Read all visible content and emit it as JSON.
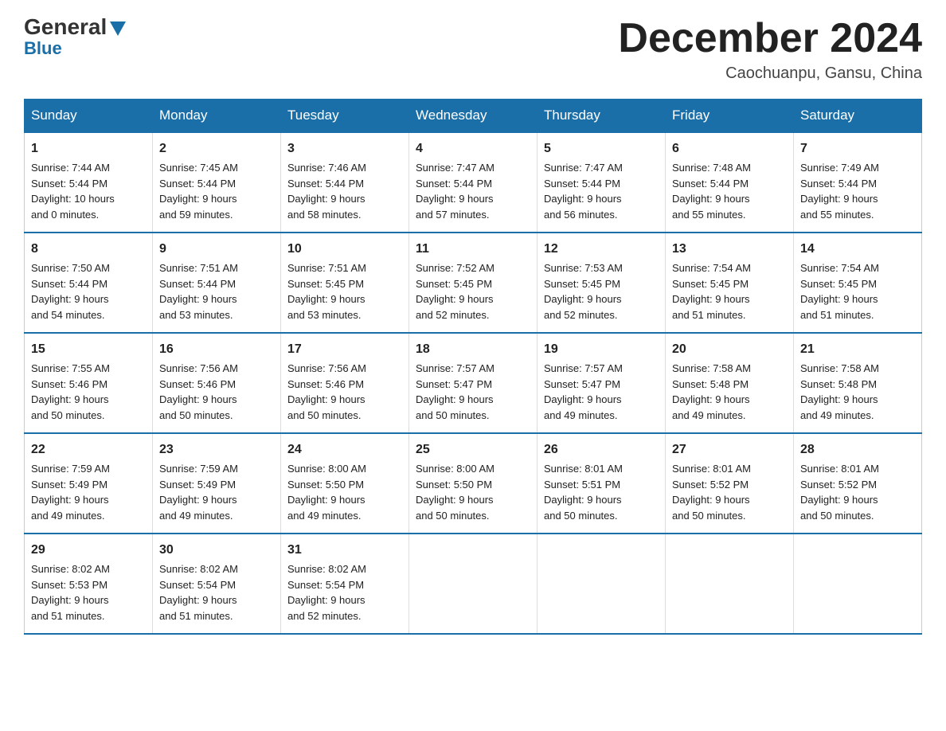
{
  "logo": {
    "general": "General",
    "blue": "Blue"
  },
  "title": "December 2024",
  "location": "Caochuanpu, Gansu, China",
  "days_header": [
    "Sunday",
    "Monday",
    "Tuesday",
    "Wednesday",
    "Thursday",
    "Friday",
    "Saturday"
  ],
  "weeks": [
    [
      {
        "day": "1",
        "info": "Sunrise: 7:44 AM\nSunset: 5:44 PM\nDaylight: 10 hours\nand 0 minutes."
      },
      {
        "day": "2",
        "info": "Sunrise: 7:45 AM\nSunset: 5:44 PM\nDaylight: 9 hours\nand 59 minutes."
      },
      {
        "day": "3",
        "info": "Sunrise: 7:46 AM\nSunset: 5:44 PM\nDaylight: 9 hours\nand 58 minutes."
      },
      {
        "day": "4",
        "info": "Sunrise: 7:47 AM\nSunset: 5:44 PM\nDaylight: 9 hours\nand 57 minutes."
      },
      {
        "day": "5",
        "info": "Sunrise: 7:47 AM\nSunset: 5:44 PM\nDaylight: 9 hours\nand 56 minutes."
      },
      {
        "day": "6",
        "info": "Sunrise: 7:48 AM\nSunset: 5:44 PM\nDaylight: 9 hours\nand 55 minutes."
      },
      {
        "day": "7",
        "info": "Sunrise: 7:49 AM\nSunset: 5:44 PM\nDaylight: 9 hours\nand 55 minutes."
      }
    ],
    [
      {
        "day": "8",
        "info": "Sunrise: 7:50 AM\nSunset: 5:44 PM\nDaylight: 9 hours\nand 54 minutes."
      },
      {
        "day": "9",
        "info": "Sunrise: 7:51 AM\nSunset: 5:44 PM\nDaylight: 9 hours\nand 53 minutes."
      },
      {
        "day": "10",
        "info": "Sunrise: 7:51 AM\nSunset: 5:45 PM\nDaylight: 9 hours\nand 53 minutes."
      },
      {
        "day": "11",
        "info": "Sunrise: 7:52 AM\nSunset: 5:45 PM\nDaylight: 9 hours\nand 52 minutes."
      },
      {
        "day": "12",
        "info": "Sunrise: 7:53 AM\nSunset: 5:45 PM\nDaylight: 9 hours\nand 52 minutes."
      },
      {
        "day": "13",
        "info": "Sunrise: 7:54 AM\nSunset: 5:45 PM\nDaylight: 9 hours\nand 51 minutes."
      },
      {
        "day": "14",
        "info": "Sunrise: 7:54 AM\nSunset: 5:45 PM\nDaylight: 9 hours\nand 51 minutes."
      }
    ],
    [
      {
        "day": "15",
        "info": "Sunrise: 7:55 AM\nSunset: 5:46 PM\nDaylight: 9 hours\nand 50 minutes."
      },
      {
        "day": "16",
        "info": "Sunrise: 7:56 AM\nSunset: 5:46 PM\nDaylight: 9 hours\nand 50 minutes."
      },
      {
        "day": "17",
        "info": "Sunrise: 7:56 AM\nSunset: 5:46 PM\nDaylight: 9 hours\nand 50 minutes."
      },
      {
        "day": "18",
        "info": "Sunrise: 7:57 AM\nSunset: 5:47 PM\nDaylight: 9 hours\nand 50 minutes."
      },
      {
        "day": "19",
        "info": "Sunrise: 7:57 AM\nSunset: 5:47 PM\nDaylight: 9 hours\nand 49 minutes."
      },
      {
        "day": "20",
        "info": "Sunrise: 7:58 AM\nSunset: 5:48 PM\nDaylight: 9 hours\nand 49 minutes."
      },
      {
        "day": "21",
        "info": "Sunrise: 7:58 AM\nSunset: 5:48 PM\nDaylight: 9 hours\nand 49 minutes."
      }
    ],
    [
      {
        "day": "22",
        "info": "Sunrise: 7:59 AM\nSunset: 5:49 PM\nDaylight: 9 hours\nand 49 minutes."
      },
      {
        "day": "23",
        "info": "Sunrise: 7:59 AM\nSunset: 5:49 PM\nDaylight: 9 hours\nand 49 minutes."
      },
      {
        "day": "24",
        "info": "Sunrise: 8:00 AM\nSunset: 5:50 PM\nDaylight: 9 hours\nand 49 minutes."
      },
      {
        "day": "25",
        "info": "Sunrise: 8:00 AM\nSunset: 5:50 PM\nDaylight: 9 hours\nand 50 minutes."
      },
      {
        "day": "26",
        "info": "Sunrise: 8:01 AM\nSunset: 5:51 PM\nDaylight: 9 hours\nand 50 minutes."
      },
      {
        "day": "27",
        "info": "Sunrise: 8:01 AM\nSunset: 5:52 PM\nDaylight: 9 hours\nand 50 minutes."
      },
      {
        "day": "28",
        "info": "Sunrise: 8:01 AM\nSunset: 5:52 PM\nDaylight: 9 hours\nand 50 minutes."
      }
    ],
    [
      {
        "day": "29",
        "info": "Sunrise: 8:02 AM\nSunset: 5:53 PM\nDaylight: 9 hours\nand 51 minutes."
      },
      {
        "day": "30",
        "info": "Sunrise: 8:02 AM\nSunset: 5:54 PM\nDaylight: 9 hours\nand 51 minutes."
      },
      {
        "day": "31",
        "info": "Sunrise: 8:02 AM\nSunset: 5:54 PM\nDaylight: 9 hours\nand 52 minutes."
      },
      {
        "day": "",
        "info": ""
      },
      {
        "day": "",
        "info": ""
      },
      {
        "day": "",
        "info": ""
      },
      {
        "day": "",
        "info": ""
      }
    ]
  ]
}
